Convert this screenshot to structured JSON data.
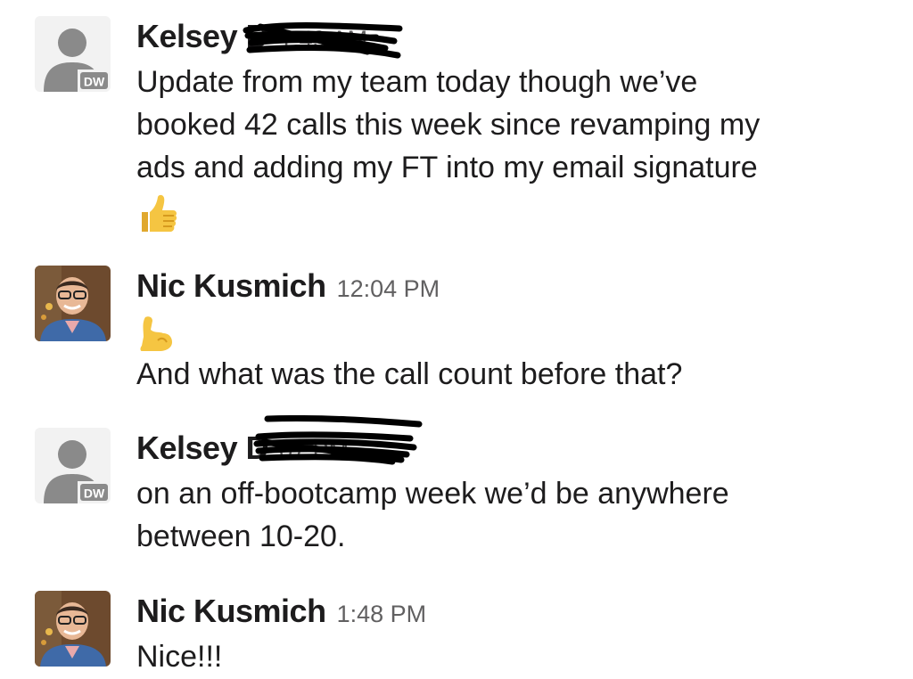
{
  "messages": [
    {
      "sender": "Kelsey D",
      "time": "1:49 AM",
      "avatar_initials": "DW",
      "text_lines": [
        "Update from my team today though we’ve",
        "booked 42 calls this week since revamping my",
        "ads and adding my FT into my email signature"
      ],
      "emoji": "thumbs-up"
    },
    {
      "sender": "Nic Kusmich",
      "time": "12:04 PM",
      "emoji": "flexed-biceps",
      "text_lines": [
        "And what was the call count before that?"
      ]
    },
    {
      "sender": "Kelsey D",
      "time": "07 PM",
      "avatar_initials": "DW",
      "text_lines": [
        "on an off-bootcamp week we’d be anywhere",
        "between 10-20."
      ]
    },
    {
      "sender": "Nic Kusmich",
      "time": "1:48 PM",
      "text_lines": [
        "Nice!!!"
      ]
    }
  ],
  "colors": {
    "text": "#1d1c1d",
    "timestamp": "#616061",
    "generic_avatar_bg": "#f2f2f2",
    "generic_avatar_figure": "#8a8a8a",
    "redaction": "#000000",
    "emoji_skin": "#f5c542"
  }
}
